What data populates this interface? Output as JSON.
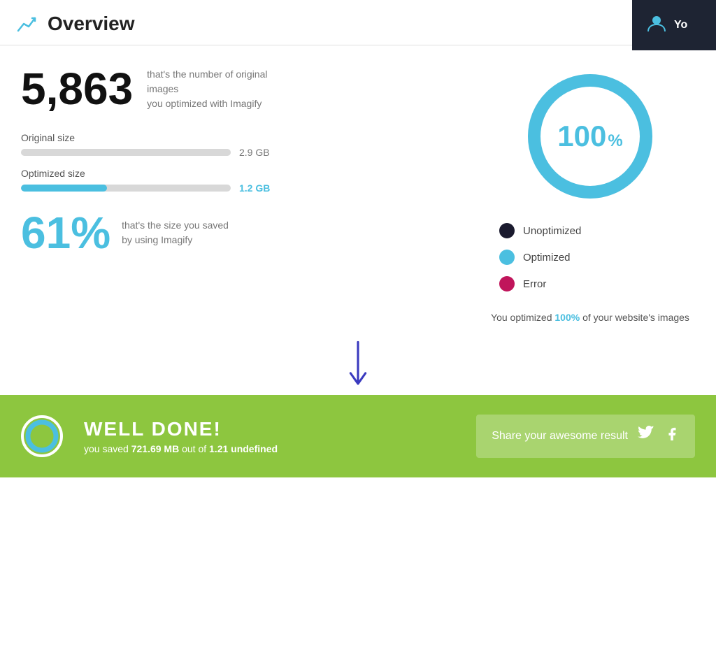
{
  "header": {
    "title": "Overview",
    "icon_label": "chart-icon",
    "user_label": "Yo"
  },
  "stats": {
    "image_count": "5,863",
    "image_count_desc_line1": "that's the number of original images",
    "image_count_desc_line2": "you optimized with Imagify",
    "original_size_label": "Original size",
    "original_size_value": "2.9 GB",
    "optimized_size_label": "Optimized size",
    "optimized_size_value": "1.2 GB",
    "saved_percent": "61%",
    "saved_desc_line1": "that's the size you saved",
    "saved_desc_line2": "by using Imagify"
  },
  "donut": {
    "percent_value": "100",
    "percent_symbol": "%"
  },
  "legend": {
    "unoptimized_label": "Unoptimized",
    "optimized_label": "Optimized",
    "error_label": "Error"
  },
  "optimization_summary": {
    "text_before": "You optimized ",
    "highlight": "100%",
    "text_after": " of your website's images"
  },
  "banner": {
    "title": "WELL DONE!",
    "subtitle_before": "you saved ",
    "subtitle_bold1": "721.69 MB",
    "subtitle_middle": " out of ",
    "subtitle_bold2": "1.21 undefined",
    "share_label": "Share your awesome result"
  }
}
